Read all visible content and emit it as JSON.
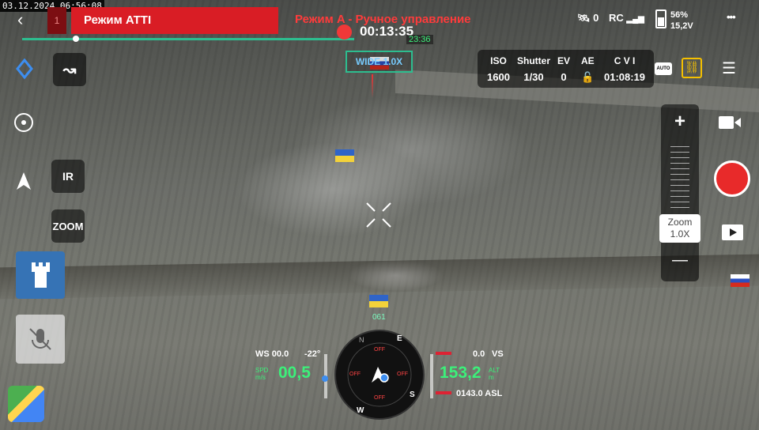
{
  "timestamp": "03.12.2024 06:56:08",
  "top_bar": {
    "back_glyph": "‹",
    "badge": "1",
    "mode": "Режим ATTI",
    "mode_sub": "Режим A - Ручное управление",
    "sat_count": "0",
    "rc_label": "RC",
    "battery_pct": "56%",
    "battery_v": "15,2V",
    "more_glyph": "•••"
  },
  "recording": {
    "time": "00:13:35",
    "sub_time": "23:36",
    "progress": 0.07
  },
  "wide_label": "WIDE 1.0X",
  "camera": {
    "iso_label": "ISO",
    "iso": "1600",
    "shutter_label": "Shutter",
    "shutter": "1/30",
    "ev_label": "EV",
    "ev": "0",
    "ae_label": "AE",
    "storage_label": "C V I",
    "storage_time": "01:08:19",
    "auto_label": "AUTO"
  },
  "zoom": {
    "plus": "+",
    "minus": "—",
    "label": "Zoom",
    "value": "1.0X"
  },
  "left_buttons": {
    "ir": "IR",
    "zoom": "ZOOM"
  },
  "telemetry": {
    "ws": "WS 00.0",
    "ws_dir": "-22°",
    "spd_label": "SPD",
    "spd_unit": "m/s",
    "spd": "00,5",
    "alt": "153,2",
    "alt_label": "ALT",
    "alt_unit": "m",
    "vs_value": "0.0",
    "vs_label": "VS",
    "asl": "0143.0 ASL",
    "heading": "061",
    "compass_n": "N",
    "compass_e": "E",
    "compass_s": "S",
    "compass_w": "W",
    "off": "OFF"
  },
  "colors": {
    "accent": "#2dbd8f",
    "record": "#e82a2a",
    "mode_red": "#d91d25",
    "green": "#3cf07a"
  }
}
